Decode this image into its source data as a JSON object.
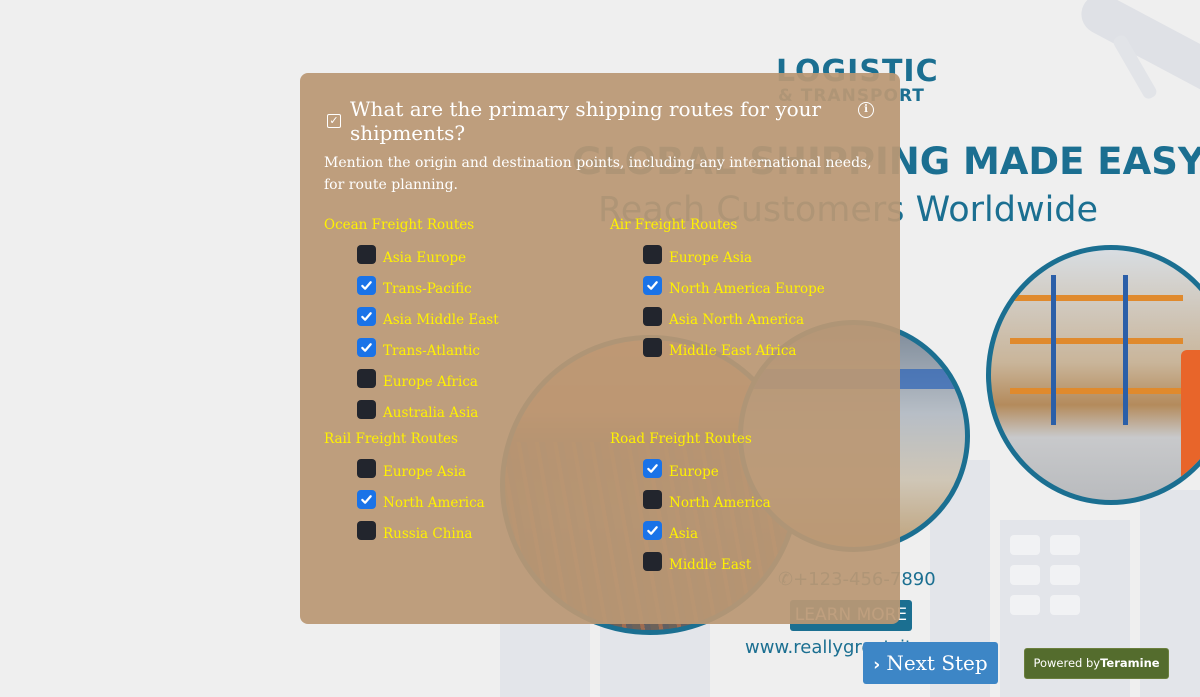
{
  "poster": {
    "logo_main": "LOGISTIC",
    "logo_sub": "& TRANSPORT",
    "headline": "GLOBAL SHIPPING MADE EASY",
    "tagline": "Reach Customers Worldwide",
    "phone": "+123-456-7890",
    "learn_more": "LEARN MORE",
    "website": "www.reallygreatsite.com"
  },
  "question": {
    "icon": "checkbox-question-icon",
    "title": "What are the primary shipping routes for your shipments?",
    "info_icon": "info-icon",
    "description": "Mention the origin and destination points, including any international needs, for route planning."
  },
  "groups": [
    {
      "title": "Ocean Freight Routes",
      "options": [
        {
          "label": "Asia Europe",
          "checked": false
        },
        {
          "label": "Trans-Pacific",
          "checked": true
        },
        {
          "label": "Asia Middle East",
          "checked": true
        },
        {
          "label": "Trans-Atlantic",
          "checked": true
        },
        {
          "label": "Europe Africa",
          "checked": false
        },
        {
          "label": "Australia Asia",
          "checked": false
        }
      ]
    },
    {
      "title": "Air Freight Routes",
      "options": [
        {
          "label": "Europe Asia",
          "checked": false
        },
        {
          "label": "North America Europe",
          "checked": true
        },
        {
          "label": "Asia North America",
          "checked": false
        },
        {
          "label": "Middle East Africa",
          "checked": false
        }
      ]
    },
    {
      "title": "Rail Freight Routes",
      "options": [
        {
          "label": "Europe Asia",
          "checked": false
        },
        {
          "label": "North America",
          "checked": true
        },
        {
          "label": "Russia China",
          "checked": false
        }
      ]
    },
    {
      "title": "Road Freight Routes",
      "options": [
        {
          "label": "Europe",
          "checked": true
        },
        {
          "label": "North America",
          "checked": false
        },
        {
          "label": "Asia",
          "checked": true
        },
        {
          "label": "Middle East",
          "checked": false
        }
      ]
    }
  ],
  "footer": {
    "next_label": "Next Step",
    "powered_prefix": "Powered by",
    "powered_brand": "Teramine"
  },
  "colors": {
    "panel": "#ba9874",
    "option_text": "#fff200",
    "checkbox_checked": "#1a73e8",
    "checkbox_unchecked": "#22252d",
    "next_button": "#3d86c6",
    "powered_badge": "#546c2d",
    "brand_teal": "#1b6f91"
  }
}
